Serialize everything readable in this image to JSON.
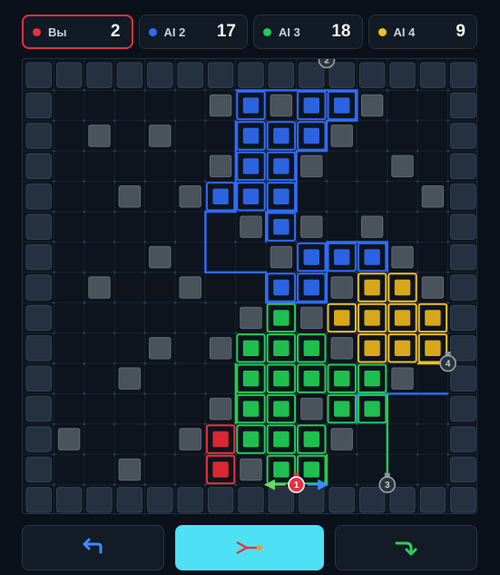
{
  "players": [
    {
      "name": "Вы",
      "score": "2",
      "color": "#e83140",
      "active": true
    },
    {
      "name": "AI 2",
      "score": "17",
      "color": "#2f6bff",
      "active": false
    },
    {
      "name": "AI 3",
      "score": "18",
      "color": "#22cc55",
      "active": false
    },
    {
      "name": "AI 4",
      "score": "9",
      "color": "#f0c020",
      "active": false
    }
  ],
  "board": {
    "cols": 15,
    "rows": 15,
    "blue_cells": [
      [
        7,
        1
      ],
      [
        9,
        1
      ],
      [
        10,
        1
      ],
      [
        7,
        2
      ],
      [
        8,
        2
      ],
      [
        9,
        2
      ],
      [
        7,
        3
      ],
      [
        8,
        3
      ],
      [
        6,
        4
      ],
      [
        7,
        4
      ],
      [
        8,
        4
      ],
      [
        8,
        5
      ],
      [
        9,
        6
      ],
      [
        10,
        6
      ],
      [
        11,
        6
      ],
      [
        8,
        7
      ],
      [
        9,
        7
      ]
    ],
    "green_cells": [
      [
        8,
        8
      ],
      [
        7,
        9
      ],
      [
        8,
        9
      ],
      [
        9,
        9
      ],
      [
        7,
        10
      ],
      [
        8,
        10
      ],
      [
        9,
        10
      ],
      [
        10,
        10
      ],
      [
        11,
        10
      ],
      [
        7,
        11
      ],
      [
        8,
        11
      ],
      [
        10,
        11
      ],
      [
        11,
        11
      ],
      [
        7,
        12
      ],
      [
        8,
        12
      ],
      [
        9,
        12
      ],
      [
        8,
        13
      ],
      [
        9,
        13
      ]
    ],
    "yellow_cells": [
      [
        11,
        7
      ],
      [
        12,
        7
      ],
      [
        10,
        8
      ],
      [
        11,
        8
      ],
      [
        12,
        8
      ],
      [
        13,
        8
      ],
      [
        11,
        9
      ],
      [
        12,
        9
      ],
      [
        13,
        9
      ]
    ],
    "red_cells": [
      [
        6,
        12
      ],
      [
        6,
        13
      ]
    ],
    "gray_cells": [
      [
        6,
        1
      ],
      [
        8,
        1
      ],
      [
        11,
        1
      ],
      [
        2,
        2
      ],
      [
        4,
        2
      ],
      [
        10,
        2
      ],
      [
        6,
        3
      ],
      [
        9,
        3
      ],
      [
        12,
        3
      ],
      [
        3,
        4
      ],
      [
        5,
        4
      ],
      [
        13,
        4
      ],
      [
        7,
        5
      ],
      [
        9,
        5
      ],
      [
        11,
        5
      ],
      [
        4,
        6
      ],
      [
        8,
        6
      ],
      [
        12,
        6
      ],
      [
        2,
        7
      ],
      [
        5,
        7
      ],
      [
        10,
        7
      ],
      [
        13,
        7
      ],
      [
        7,
        8
      ],
      [
        9,
        8
      ],
      [
        4,
        9
      ],
      [
        6,
        9
      ],
      [
        10,
        9
      ],
      [
        3,
        10
      ],
      [
        12,
        10
      ],
      [
        6,
        11
      ],
      [
        9,
        11
      ],
      [
        1,
        12
      ],
      [
        5,
        12
      ],
      [
        10,
        12
      ],
      [
        3,
        13
      ],
      [
        7,
        13
      ]
    ],
    "markers": [
      {
        "id": "marker-2",
        "label": "2",
        "color": "#9aa4ae"
      },
      {
        "id": "marker-4",
        "label": "4",
        "color": "#9aa4ae"
      },
      {
        "id": "marker-3",
        "label": "3",
        "color": "#9aa4ae"
      },
      {
        "id": "marker-1",
        "label": "1",
        "color": "#e83140"
      }
    ]
  },
  "controls": {
    "undo_icon": "undo-arrow-icon",
    "action_icon": "laser-shot-icon",
    "redo_icon": "redo-arrow-icon"
  }
}
